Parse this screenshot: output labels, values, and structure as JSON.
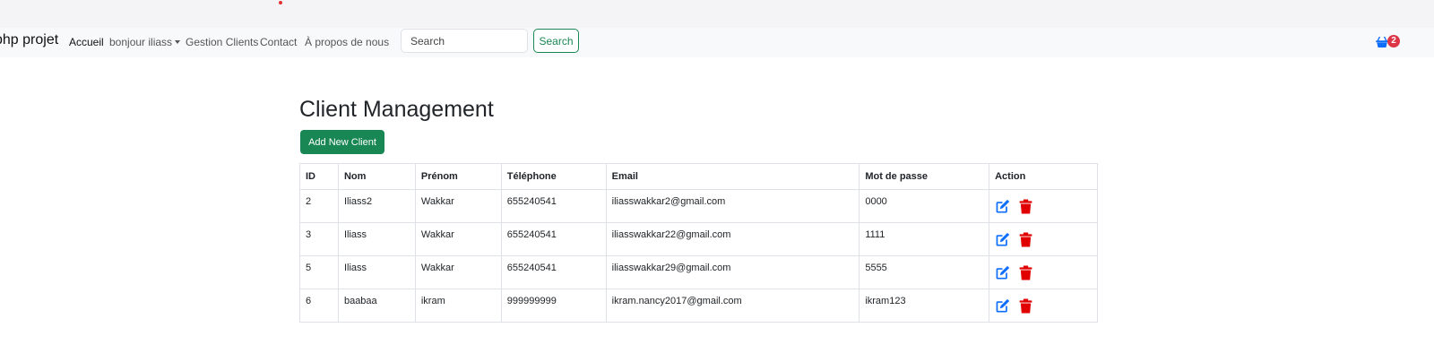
{
  "colors": {
    "accent_green": "#198754",
    "edit_blue": "#0d6efd",
    "delete_red": "#e00000",
    "badge_red": "#dc3545"
  },
  "navbar": {
    "brand": "php projet",
    "links": [
      {
        "label": "Accueil",
        "active": true
      },
      {
        "label": "bonjour iliass",
        "dropdown": true
      },
      {
        "label": "Gestion Clients"
      },
      {
        "label": "Contact"
      },
      {
        "label": "À propos de nous"
      }
    ],
    "search_placeholder": "Search",
    "search_button": "Search",
    "cart_icon": "basket-icon",
    "cart_count": "2"
  },
  "main": {
    "title": "Client Management",
    "add_button": "Add New Client",
    "table": {
      "headers": [
        "ID",
        "Nom",
        "Prénom",
        "Téléphone",
        "Email",
        "Mot de passe",
        "Action"
      ],
      "rows": [
        [
          "2",
          "Iliass2",
          "Wakkar",
          "655240541",
          "iliasswakkar2@gmail.com",
          "0000"
        ],
        [
          "3",
          "Iliass",
          "Wakkar",
          "655240541",
          "iliasswakkar22@gmail.com",
          "1111"
        ],
        [
          "5",
          "Iliass",
          "Wakkar",
          "655240541",
          "iliasswakkar29@gmail.com",
          "5555"
        ],
        [
          "6",
          "baabaa",
          "ikram",
          "999999999",
          "ikram.nancy2017@gmail.com",
          "ikram123"
        ]
      ],
      "action_icons": [
        "edit-icon",
        "trash-icon"
      ]
    }
  }
}
